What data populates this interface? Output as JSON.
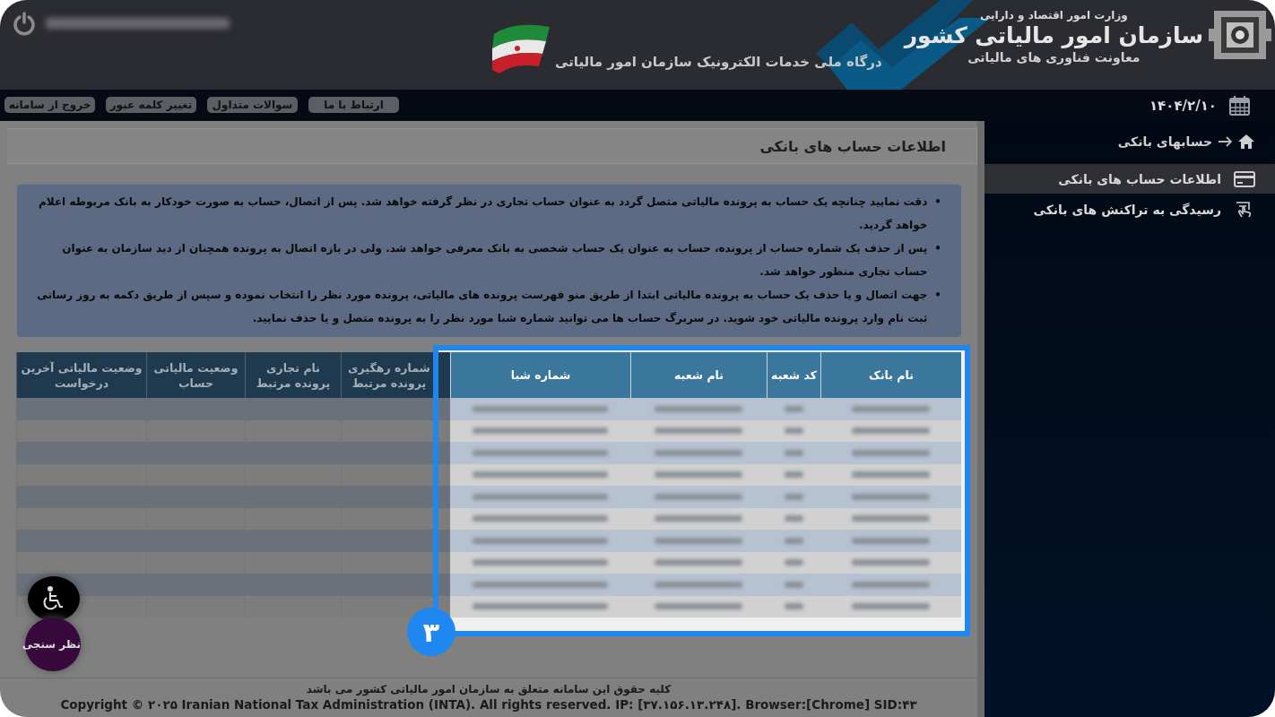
{
  "header": {
    "user": {
      "blurred": true
    },
    "ministry": "وزارت امور اقتصاد و دارایی",
    "organization": "سازمان امور مالیاتی کشور",
    "deputy": "معاونت فناوری های مالیاتی",
    "portal_title": "درگاه ملی خدمات الکترونیک سازمان امور مالیاتی"
  },
  "nav_buttons": [
    "ارتباط با ما",
    "سوالات متداول",
    "تغییر کلمه عبور",
    "خروج از سامانه"
  ],
  "date": "۱۴۰۴/۲/۱۰",
  "sidebar": {
    "breadcrumb": "حسابهای بانکی",
    "items": [
      {
        "label": "اطلاعات حساب های بانکی",
        "selected": true,
        "kind": "card"
      },
      {
        "label": "رسیدگی به تراکنش های بانکی",
        "selected": false,
        "kind": "hand"
      }
    ]
  },
  "page_title": "اطلاعات حساب های بانکی",
  "notes": [
    {
      "bullet": "•",
      "text": "دقت نمایید چنانچه یک حساب به پرونده مالیاتی متصل گردد به عنوان حساب تجاری در نظر گرفته خواهد شد. پس از اتصال، حساب به صورت خودکار به بانک مربوطه اعلام خواهد گردید."
    },
    {
      "bullet": "•",
      "text": "پس از حذف یک شماره حساب از پرونده، حساب به عنوان یک حساب شخصی به بانک معرفی خواهد شد. ولی در بازه اتصال به پرونده همچنان از دید سازمان به عنوان حساب تجاری منظور خواهد شد."
    },
    {
      "bullet": "•",
      "text": "جهت اتصال و یا حذف یک حساب به پرونده مالیاتی ابتدا از طریق منو فهرست پرونده های مالیاتی، پرونده مورد نظر را انتخاب نموده و سپس از طریق دکمه به روز رسانی ثبت نام وارد پرونده مالیاتی خود شوید. در سربرگ حساب ها می توانید شماره شبا مورد نظر را به پرونده متصل و یا حذف نمایید."
    }
  ],
  "table": {
    "columns": [
      {
        "label": "نام بانک",
        "highlighted": true
      },
      {
        "label": "کد شعبه",
        "highlighted": true
      },
      {
        "label": "نام شعبه",
        "highlighted": true
      },
      {
        "label": "شماره شبا",
        "highlighted": true
      },
      {
        "label": "شماره رهگیری پرونده مرتبط",
        "highlighted": false
      },
      {
        "label": "نام تجاری پرونده مرتبط",
        "highlighted": false
      },
      {
        "label": "وضعیت مالیاتی حساب",
        "highlighted": false
      },
      {
        "label": "وضعیت مالیاتی آخرین درخواست",
        "highlighted": false
      }
    ],
    "rows": [
      {
        "blurred": true
      },
      {
        "blurred": true
      },
      {
        "blurred": true
      },
      {
        "blurred": true
      },
      {
        "blurred": true
      },
      {
        "blurred": true
      },
      {
        "blurred": true
      },
      {
        "blurred": true
      },
      {
        "blurred": true
      },
      {
        "blurred": true
      }
    ]
  },
  "annotation": {
    "number": "۳"
  },
  "survey_button": "نظر سنجی",
  "footer": {
    "rights": "کلیه حقوق این سامانه متعلق به سازمان امور مالیاتی کشور می باشد",
    "copyright": "Copyright © ۲۰۲۵ Iranian National Tax Administration (INTA). All rights reserved. IP: [۳۷.۱۵۶.۱۳.۲۴۸]. Browser:[Chrome] SID:۴۳"
  }
}
